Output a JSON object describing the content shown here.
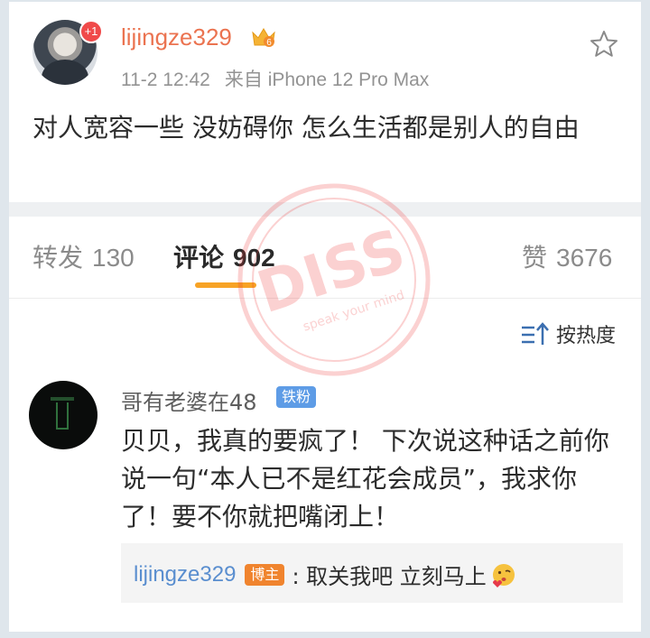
{
  "post": {
    "avatar_badge": "+1",
    "username": "lijingze329",
    "level_badge": "6",
    "time": "11-2 12:42",
    "source": "来自 iPhone 12 Pro Max",
    "text": "对人宽容一些 没妨碍你 怎么生活都是别人的自由"
  },
  "tabs": [
    {
      "label": "转发",
      "count": "130"
    },
    {
      "label": "评论",
      "count": "902"
    },
    {
      "label": "赞",
      "count": "3676"
    }
  ],
  "sort": {
    "label": "按热度"
  },
  "comment": {
    "username": "哥有老婆在48",
    "badge": "铁粉",
    "text": "贝贝，我真的要疯了！ 下次说这种话之前你说一句“本人已不是红花会成员”，我求你了！要不你就把嘴闭上！",
    "reply": {
      "username": "lijingze329",
      "badge": "博主",
      "text": ": 取关我吧 立刻马上"
    }
  },
  "watermark": {
    "text": "DISS",
    "slogan": "speak your mind"
  },
  "colors": {
    "accent": "#eb7350",
    "tab_underline": "#f7a325",
    "link": "#5a8ecf",
    "fan_badge": "#5e9ce6",
    "host_badge": "#f0842e"
  },
  "icons": {
    "favorite": "star-outline-icon",
    "sort": "sort-arrow-icon",
    "crown": "vip-crown-icon",
    "emoji": "kiss-emoji-icon"
  }
}
